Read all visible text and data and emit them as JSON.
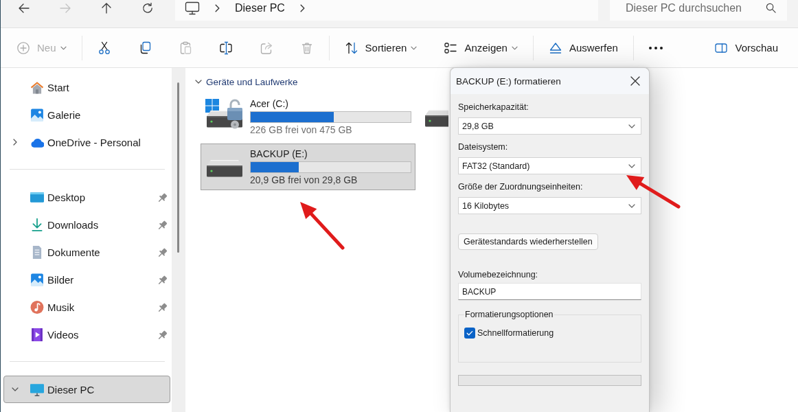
{
  "navigation": {
    "buttons": [
      {
        "kind": "back",
        "disabled": false
      },
      {
        "kind": "forward",
        "disabled": true
      },
      {
        "kind": "up",
        "disabled": false
      },
      {
        "kind": "refresh",
        "disabled": false
      }
    ],
    "address": {
      "kind": "pc",
      "path": [
        "Dieser PC"
      ]
    },
    "search": {
      "placeholder": "Dieser PC durchsuchen"
    }
  },
  "command_bar": {
    "groups": [
      {
        "items": [
          {
            "kind": "new",
            "label": "Neu",
            "dropdown": true,
            "disabled": true
          }
        ]
      },
      {
        "items": [
          {
            "kind": "cut",
            "dropdown": false,
            "disabled": false
          },
          {
            "kind": "copy",
            "dropdown": false,
            "disabled": false
          },
          {
            "kind": "paste",
            "dropdown": false,
            "disabled": true
          },
          {
            "kind": "rename",
            "dropdown": false,
            "disabled": false
          },
          {
            "kind": "share",
            "dropdown": false,
            "disabled": true
          },
          {
            "kind": "delete",
            "dropdown": false,
            "disabled": true
          }
        ]
      },
      {
        "items": [
          {
            "kind": "sort",
            "label": "Sortieren",
            "dropdown": true,
            "disabled": false
          },
          {
            "kind": "view",
            "label": "Anzeigen",
            "dropdown": true,
            "disabled": false
          }
        ]
      },
      {
        "items": [
          {
            "kind": "eject",
            "label": "Auswerfen",
            "dropdown": false,
            "disabled": false
          }
        ]
      },
      {
        "items": [
          {
            "kind": "more",
            "dropdown": false,
            "disabled": false
          }
        ]
      }
    ],
    "end_items": [
      {
        "kind": "preview",
        "label": "Vorschau",
        "dropdown": false,
        "disabled": false
      }
    ]
  },
  "sidebar": {
    "sections": [
      {
        "items": [
          {
            "kind": "home",
            "label": "Start",
            "selected": false
          },
          {
            "kind": "gallery",
            "label": "Galerie",
            "selected": false
          },
          {
            "kind": "cloud",
            "label": "OneDrive - Personal",
            "expanded": false,
            "selected": false
          }
        ]
      },
      {
        "items": [
          {
            "kind": "desktop",
            "label": "Desktop",
            "pinned": true,
            "selected": false
          },
          {
            "kind": "download",
            "label": "Downloads",
            "pinned": true,
            "selected": false
          },
          {
            "kind": "document",
            "label": "Dokumente",
            "pinned": true,
            "selected": false
          },
          {
            "kind": "pictures",
            "label": "Bilder",
            "pinned": true,
            "selected": false
          },
          {
            "kind": "music",
            "label": "Musik",
            "pinned": true,
            "selected": false
          },
          {
            "kind": "videos",
            "label": "Videos",
            "pinned": true,
            "selected": false
          }
        ]
      },
      {
        "items": [
          {
            "kind": "pc",
            "label": "Dieser PC",
            "expanded": true,
            "selected": true
          }
        ]
      }
    ]
  },
  "devices": {
    "title": "Geräte und Laufwerke",
    "expanded": true,
    "drives": [
      {
        "kind": "system",
        "name": "Acer (C:)",
        "level": 0.52,
        "free_space": "226 GB frei von 475 GB",
        "selected": false
      },
      {
        "kind": "drive",
        "selected": false
      },
      {
        "kind": "drive",
        "name": "BACKUP (E:)",
        "level": 0.3,
        "free_space": "20,9 GB frei von 29,8 GB",
        "selected": true
      }
    ]
  },
  "dialog": {
    "title": "BACKUP (E:) formatieren",
    "fields": [
      {
        "kind": "select",
        "label": "Speicherkapazität:",
        "value": "29,8 GB"
      },
      {
        "kind": "select",
        "label": "Dateisystem:",
        "value": "FAT32 (Standard)"
      },
      {
        "kind": "select",
        "label": "Größe der Zuordnungseinheiten:",
        "value": "16 Kilobytes"
      },
      {
        "kind": "button",
        "label": "Gerätestandards wiederherstellen"
      },
      {
        "kind": "text",
        "label": "Volumebezeichnung:",
        "value": "BACKUP"
      }
    ],
    "options": {
      "title": "Formatierungsoptionen",
      "checkboxes": [
        {
          "label": "Schnellformatierung",
          "checked": true
        }
      ]
    },
    "progress": {
      "level": 0
    }
  },
  "annotations": [
    {
      "kind": "arrow"
    },
    {
      "kind": "arrow"
    }
  ]
}
